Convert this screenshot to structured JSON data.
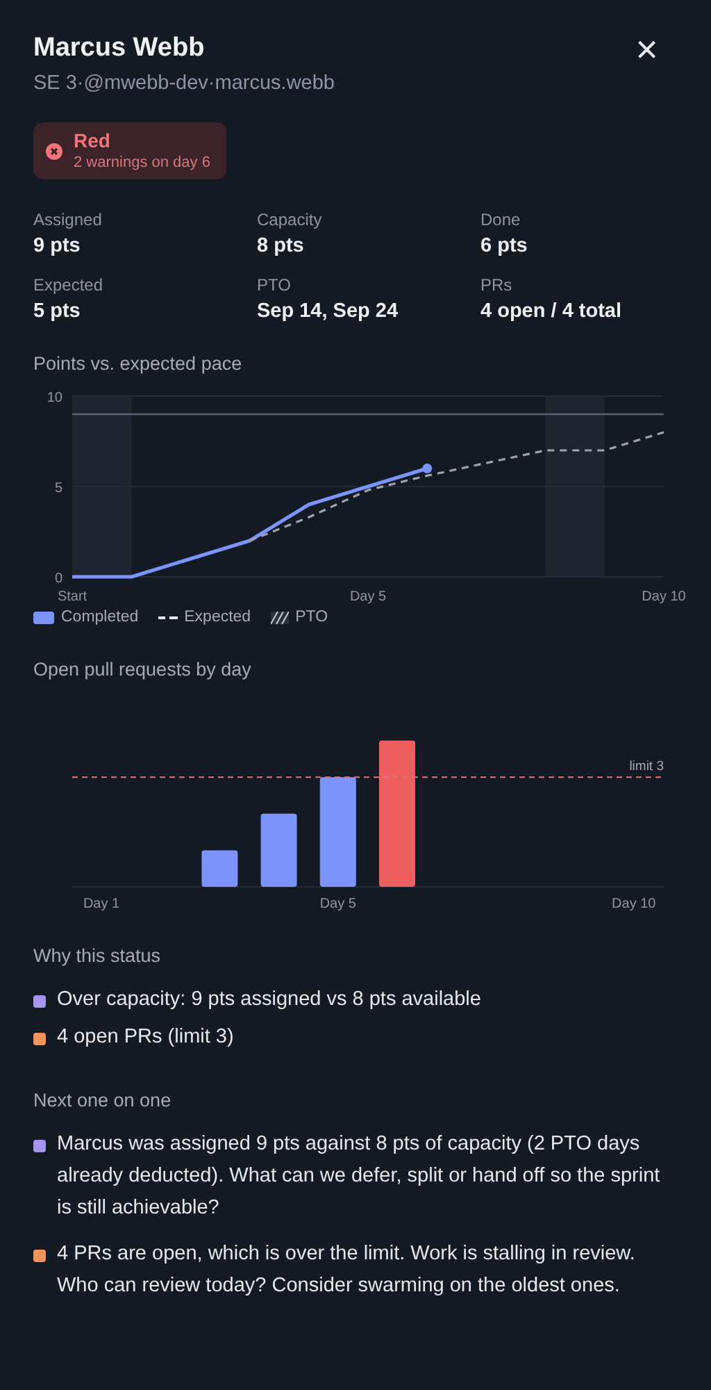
{
  "header": {
    "name": "Marcus Webb",
    "subtitle": [
      "SE 3",
      "@mwebb-dev",
      "marcus.webb"
    ],
    "separator": "·",
    "close": "×"
  },
  "status": {
    "kind": "red",
    "label": "Red",
    "detail": "2 warnings on day 6"
  },
  "stats": [
    {
      "label": "Assigned",
      "value": "9 pts"
    },
    {
      "label": "Capacity",
      "value": "8 pts"
    },
    {
      "label": "Done",
      "value": "6 pts"
    },
    {
      "label": "Expected",
      "value": "5 pts"
    },
    {
      "label": "PTO",
      "value": "Sep 14, Sep 24"
    },
    {
      "label": "PRs",
      "value": "4 open / 4 total"
    }
  ],
  "pace": {
    "title": "Points vs. expected pace",
    "chart_data": {
      "type": "line",
      "categories": [
        "Start",
        null,
        null,
        null,
        null,
        "Day 5",
        null,
        null,
        null,
        null,
        "Day 10"
      ],
      "ylim": [
        0,
        10
      ],
      "yticks": [
        0,
        5,
        10
      ],
      "series": [
        {
          "name": "Completed",
          "color": "#7b93fa",
          "line_style": "solid",
          "values": [
            0,
            0,
            1,
            2,
            4,
            5,
            6,
            null,
            null,
            null,
            null
          ]
        },
        {
          "name": "Expected",
          "color": "#9ca3af",
          "line_style": "dashed",
          "values": [
            null,
            null,
            null,
            2,
            3.3,
            4.8,
            5.6,
            6.3,
            7,
            7,
            8
          ]
        }
      ],
      "ref_lines": [
        {
          "axis": "y",
          "value": 9
        }
      ]
    },
    "band_legend": "PTO"
  },
  "prs": {
    "title": "Open pull requests by day",
    "axis_labels": [
      "Day 1",
      "Day 5",
      "Day 10"
    ],
    "limit_label": "limit 3"
  },
  "why": {
    "title": "Why this status",
    "items": [
      {
        "text": "Over capacity: 9 pts assigned vs 8 pts available",
        "color": "#a895f2"
      },
      {
        "text": "4 open PRs (limit 3)",
        "color": "#f4935a"
      }
    ]
  },
  "next": {
    "title": "Next one on one",
    "items": [
      {
        "text": "Marcus was assigned 9 pts against 8 pts of capacity (2 PTO days already deducted). What can we defer, split or hand off so the sprint is still achievable?",
        "color": "#a895f2"
      },
      {
        "text": "4 PRs are open, which is over the limit. Work is stalling in review. Who can review today? Consider swarming on the oldest ones.",
        "color": "#f4935a"
      }
    ]
  }
}
